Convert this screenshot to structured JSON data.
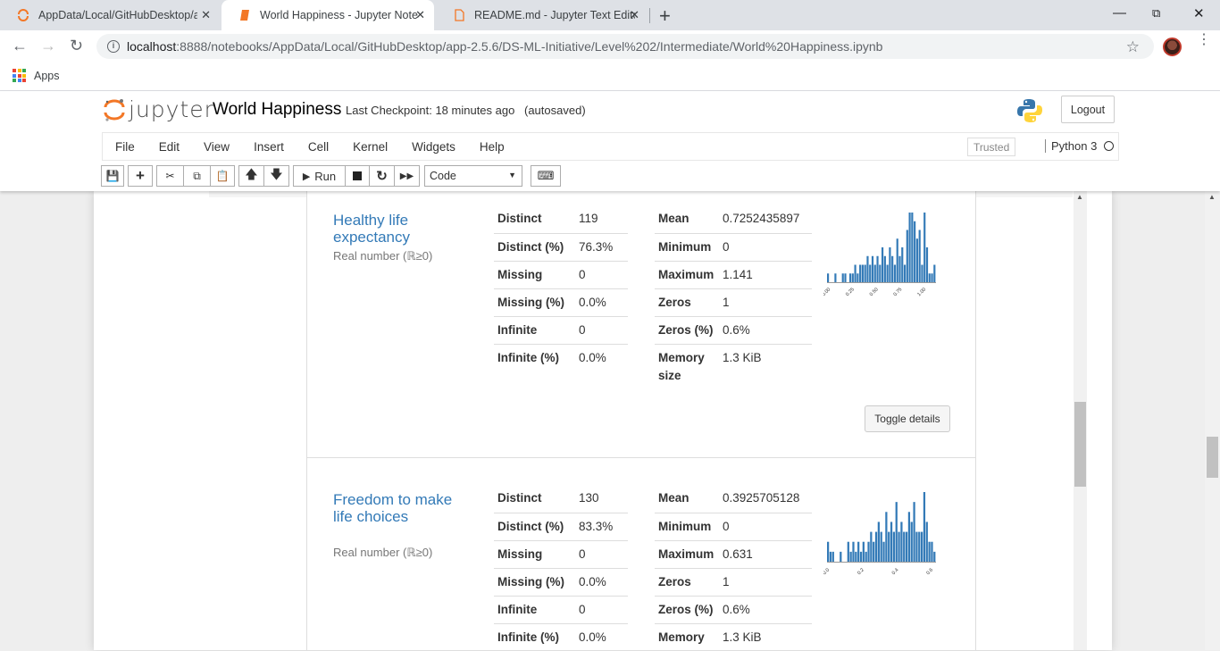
{
  "browser": {
    "tabs": [
      {
        "title": "AppData/Local/GitHubDesktop/a",
        "close": "✕"
      },
      {
        "title": "World Happiness - Jupyter Noteb",
        "close": "✕"
      },
      {
        "title": "README.md - Jupyter Text Editor",
        "close": "✕"
      }
    ],
    "new_tab": "+",
    "url_host": "localhost",
    "url_path": ":8888/notebooks/AppData/Local/GitHubDesktop/app-2.5.6/DS-ML-Initiative/Level%202/Intermediate/World%20Happiness.ipynb",
    "bookmarks_apps": "Apps"
  },
  "jupyter": {
    "logo_text": "jupyter",
    "notebook_name": "World Happiness",
    "checkpoint": "Last Checkpoint: 18 minutes ago",
    "autosaved": "(autosaved)",
    "logout": "Logout",
    "menu": [
      "File",
      "Edit",
      "View",
      "Insert",
      "Cell",
      "Kernel",
      "Widgets",
      "Help"
    ],
    "trusted": "Trusted",
    "kernel": "Python 3",
    "run_label": "Run",
    "cell_type": "Code"
  },
  "variables": [
    {
      "name": "Healthy life expectancy",
      "type": "Real number (ℝ≥0)",
      "stats_left": [
        {
          "label": "Distinct",
          "value": "119"
        },
        {
          "label": "Distinct (%)",
          "value": "76.3%"
        },
        {
          "label": "Missing",
          "value": "0"
        },
        {
          "label": "Missing (%)",
          "value": "0.0%"
        },
        {
          "label": "Infinite",
          "value": "0"
        },
        {
          "label": "Infinite (%)",
          "value": "0.0%"
        }
      ],
      "stats_right": [
        {
          "label": "Mean",
          "value": "0.7252435897"
        },
        {
          "label": "Minimum",
          "value": "0"
        },
        {
          "label": "Maximum",
          "value": "1.141"
        },
        {
          "label": "Zeros",
          "value": "1"
        },
        {
          "label": "Zeros (%)",
          "value": "0.6%"
        },
        {
          "label": "Memory size",
          "value": "1.3 KiB"
        }
      ],
      "hist_ticks": [
        "0.00",
        "0.25",
        "0.50",
        "0.75",
        "1.00"
      ],
      "hist_range": [
        0,
        1.141
      ],
      "hist_values": [
        1,
        0,
        0,
        1,
        0,
        0,
        1,
        1,
        0,
        1,
        1,
        2,
        1,
        2,
        2,
        2,
        3,
        2,
        3,
        2,
        3,
        2,
        4,
        3,
        2,
        4,
        3,
        2,
        5,
        3,
        4,
        2,
        6,
        8,
        8,
        7,
        5,
        6,
        2,
        8,
        4,
        1,
        1,
        2
      ]
    },
    {
      "name": "Freedom to make life choices",
      "type": "Real number (ℝ≥0)",
      "stats_left": [
        {
          "label": "Distinct",
          "value": "130"
        },
        {
          "label": "Distinct (%)",
          "value": "83.3%"
        },
        {
          "label": "Missing",
          "value": "0"
        },
        {
          "label": "Missing (%)",
          "value": "0.0%"
        },
        {
          "label": "Infinite",
          "value": "0"
        },
        {
          "label": "Infinite (%)",
          "value": "0.0%"
        }
      ],
      "stats_right": [
        {
          "label": "Mean",
          "value": "0.3925705128"
        },
        {
          "label": "Minimum",
          "value": "0"
        },
        {
          "label": "Maximum",
          "value": "0.631"
        },
        {
          "label": "Zeros",
          "value": "1"
        },
        {
          "label": "Zeros (%)",
          "value": "0.6%"
        },
        {
          "label": "Memory",
          "value": "1.3 KiB"
        }
      ],
      "hist_ticks": [
        "0.0",
        "0.2",
        "0.4",
        "0.6"
      ],
      "hist_range": [
        0,
        0.631
      ],
      "hist_values": [
        2,
        1,
        1,
        0,
        0,
        1,
        0,
        0,
        2,
        1,
        2,
        1,
        2,
        1,
        2,
        1,
        2,
        3,
        2,
        3,
        4,
        3,
        2,
        5,
        3,
        4,
        3,
        6,
        3,
        4,
        3,
        3,
        5,
        4,
        6,
        3,
        3,
        3,
        7,
        4,
        2,
        2,
        1
      ]
    }
  ],
  "toggle_details": "Toggle details",
  "colors": {
    "link": "#337ab7",
    "bar": "#337ab7",
    "jupyter_orange": "#f37726"
  }
}
